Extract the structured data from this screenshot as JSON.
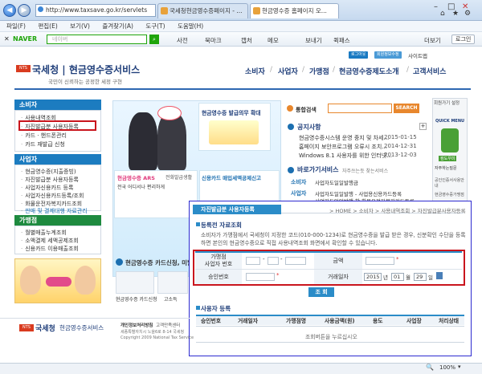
{
  "browser": {
    "address": "http://www.taxsave.go.kr/servlets",
    "tabs": [
      "국세청현금영수증페이지 - ...",
      "현금영수증 홈페이지 오..."
    ],
    "menu": [
      "파일(F)",
      "편집(E)",
      "보기(V)",
      "즐겨찾기(A)",
      "도구(T)",
      "도움말(H)"
    ],
    "toolbar": {
      "naver": "NAVER",
      "search_placeholder": "네이버",
      "items": [
        "사전",
        "북마크",
        "캡처",
        "메모",
        "보내기",
        "퀵패스"
      ],
      "more": "더보기",
      "login": "로그인"
    },
    "status_zoom": "100%"
  },
  "site": {
    "top_links": [
      "로그아웃",
      "회원정보수정",
      "사이트맵"
    ],
    "logo_badge": "NTS",
    "logo_title": "국세청 | 현금영수증서비스",
    "tagline": "국민이 신뢰하는 공정한 세정 구현",
    "gnb": [
      "소비자",
      "사업자",
      "가맹점",
      "현금영수증제도소개",
      "고객서비스"
    ]
  },
  "lnb": {
    "consumer": {
      "title": "소비자",
      "items": [
        "사용내역조회",
        "자진발급분 사용자등록",
        "카드 · 핸드폰관리",
        "카드 재발급 신청"
      ]
    },
    "business": {
      "title": "사업자",
      "items": [
        "현금영수증(지출증빙)",
        "자진발급분 사용자등록",
        "사업자신용카드 등록",
        "사업자신용카드등록/조회",
        "화물운전자복지카드조회",
        "판매 및 결제대행 자료관리"
      ]
    },
    "merchant": {
      "title": "가맹점",
      "items": [
        "월별매출누계조회",
        "소액결제 세액공제조회",
        "신용카드 이용매출조회"
      ]
    }
  },
  "center": {
    "banner_top": "현금영수증 발급의무 확대",
    "banner_ars": "현금영수증 ARS",
    "banner_ars_sub": "전화발급생활",
    "banner_ars_line": "전국 어디서나 편리하게",
    "banner_card": "신용카드 매입세액공제신고",
    "card_apply": "현금영수증 카드신청, 미발급",
    "card_link": "현금영수증 카드신청",
    "card_link2": "고소득"
  },
  "right": {
    "search_label": "통합검색",
    "search_btn": "SEARCH",
    "notice_title": "공지사항",
    "notices": [
      {
        "title": "현금영수증시스템 운영 중지 및 차세...",
        "date": "2015-01-15"
      },
      {
        "title": "홈페이지 보안프로그램 오류시 조치...",
        "date": "2014-12-31"
      },
      {
        "title": "Windows 8.1 사용자를 위한 인터넷...",
        "date": "2013-12-03"
      }
    ],
    "guide_title": "바로가기서비스",
    "guide_sub": "자주쓰는듯 찾는서비스",
    "consumer_guide": "소비자",
    "consumer_guide_item": "사업자도일일발행금",
    "business_guide": "사업자",
    "business_guide_items": [
      "사업자도일일발행 - 사업용신용카드등록",
      "사업자도일일발행 한 화물운전자복지카드등록"
    ],
    "sidebar": [
      "회원가기 설정",
      "QUICK MENU",
      "컴도우미",
      "자주하는질문",
      "공인인증서사용안내",
      "현금영수증가맹점",
      "사업자 안내"
    ]
  },
  "panel": {
    "header": "자진발급분 사용자등록",
    "breadcrumb": "> HOME > 소비자 > 사용내역조회 > 자진발급분사용자등록",
    "section1": "등록전 자료조회",
    "description": "소비자가 가맹점에서 국세청이 지정한 코드(010-000-1234)로 현금영수증을 발급 받은 경우, 신분확인 수단을 등록하면 본인의 현금영수증으로 직접 사용내역조회 화면에서 확인할 수 있습니다.",
    "form": {
      "biz_label": "가맹점\n사업자 번호",
      "amount_label": "금액",
      "approval_label": "승인번호",
      "date_label": "거래일자",
      "year": "2015",
      "year_suffix": "년",
      "month": "01",
      "month_suffix": "월",
      "day": "29",
      "day_suffix": "일",
      "dash": "-"
    },
    "search_button": "조 회",
    "section2": "사용자 등록",
    "columns": [
      "승인번호",
      "거래일자",
      "가맹점명",
      "사용금액(원)",
      "용도",
      "사업장",
      "처리상태"
    ],
    "empty_message": "조회버튼을 누르십시오"
  },
  "footer": {
    "logo": "국세청",
    "service": "현금영수증서비스",
    "links": [
      "개인정보처리방침",
      "고객만족센터"
    ],
    "address": "세종특별자치시 노을6로 8-14 국세청",
    "copyright": "Copyright 2009 National Tax Service"
  }
}
